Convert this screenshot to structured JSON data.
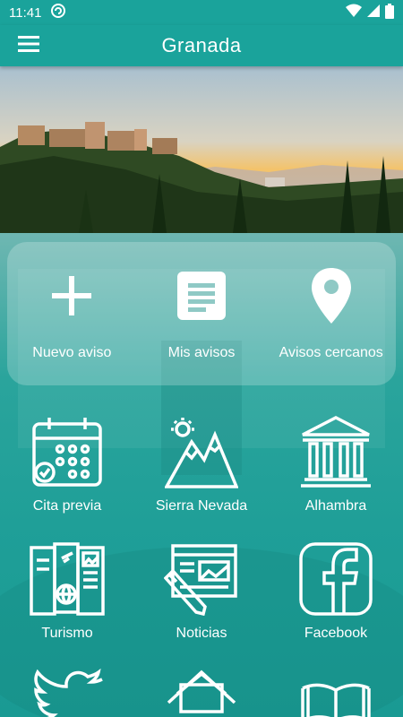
{
  "status_bar": {
    "time": "11:41"
  },
  "app_bar": {
    "title": "Granada",
    "menu_icon": "hamburger-menu-icon"
  },
  "quick_actions": [
    {
      "label": "Nuevo aviso",
      "icon": "plus-icon"
    },
    {
      "label": "Mis avisos",
      "icon": "document-list-icon"
    },
    {
      "label": "Avisos cercanos",
      "icon": "location-pin-icon"
    }
  ],
  "grid": [
    {
      "label": "Cita previa",
      "icon": "calendar-icon"
    },
    {
      "label": "Sierra Nevada",
      "icon": "mountains-icon"
    },
    {
      "label": "Alhambra",
      "icon": "monument-icon"
    },
    {
      "label": "Turismo",
      "icon": "travel-brochure-icon"
    },
    {
      "label": "Noticias",
      "icon": "newspaper-icon"
    },
    {
      "label": "Facebook",
      "icon": "facebook-icon"
    },
    {
      "label": "",
      "icon": "twitter-icon"
    },
    {
      "label": "",
      "icon": "envelope-icon"
    },
    {
      "label": "",
      "icon": "book-icon"
    }
  ],
  "colors": {
    "primary": "#1aa39b",
    "accent": "#ffffff"
  }
}
